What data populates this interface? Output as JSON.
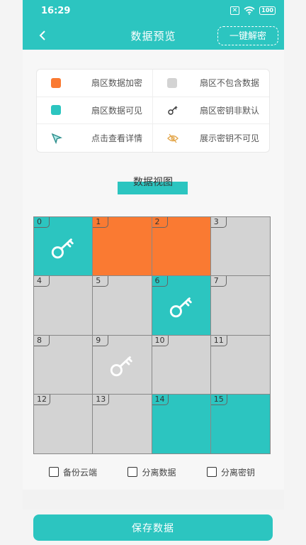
{
  "status_bar": {
    "time": "16:29",
    "sim_badge": "✕",
    "battery": "100"
  },
  "header": {
    "title": "数据预览",
    "decrypt_button": "一键解密"
  },
  "legend": [
    {
      "label": "扇区数据加密",
      "icon": "orange-square-icon",
      "color": "#fa7a32"
    },
    {
      "label": "扇区不包含数据",
      "icon": "gray-square-icon",
      "color": "#d3d3d3"
    },
    {
      "label": "扇区数据可见",
      "icon": "teal-square-icon",
      "color": "#2cc5c0"
    },
    {
      "label": "扇区密钥非默认",
      "icon": "key-icon"
    },
    {
      "label": "点击查看详情",
      "icon": "cursor-arrow-icon"
    },
    {
      "label": "展示密钥不可见",
      "icon": "eye-slash-icon"
    }
  ],
  "view_title": "数据视图",
  "colors": {
    "teal": "#2cc5c0",
    "orange": "#fa7a32",
    "gray": "#d3d3d3"
  },
  "sectors": [
    {
      "n": "0",
      "state": "visible",
      "key": true
    },
    {
      "n": "1",
      "state": "encrypted",
      "key": false
    },
    {
      "n": "2",
      "state": "encrypted",
      "key": false
    },
    {
      "n": "3",
      "state": "empty",
      "key": false
    },
    {
      "n": "4",
      "state": "empty",
      "key": false
    },
    {
      "n": "5",
      "state": "empty",
      "key": false
    },
    {
      "n": "6",
      "state": "visible",
      "key": true
    },
    {
      "n": "7",
      "state": "empty",
      "key": false
    },
    {
      "n": "8",
      "state": "empty",
      "key": false
    },
    {
      "n": "9",
      "state": "empty",
      "key": true
    },
    {
      "n": "10",
      "state": "empty",
      "key": false
    },
    {
      "n": "11",
      "state": "empty",
      "key": false
    },
    {
      "n": "12",
      "state": "empty",
      "key": false
    },
    {
      "n": "13",
      "state": "empty",
      "key": false
    },
    {
      "n": "14",
      "state": "visible",
      "key": false
    },
    {
      "n": "15",
      "state": "visible",
      "key": false
    }
  ],
  "options": [
    {
      "label": "备份云端",
      "checked": false
    },
    {
      "label": "分离数据",
      "checked": false
    },
    {
      "label": "分离密钥",
      "checked": false
    }
  ],
  "save_button": "保存数据"
}
